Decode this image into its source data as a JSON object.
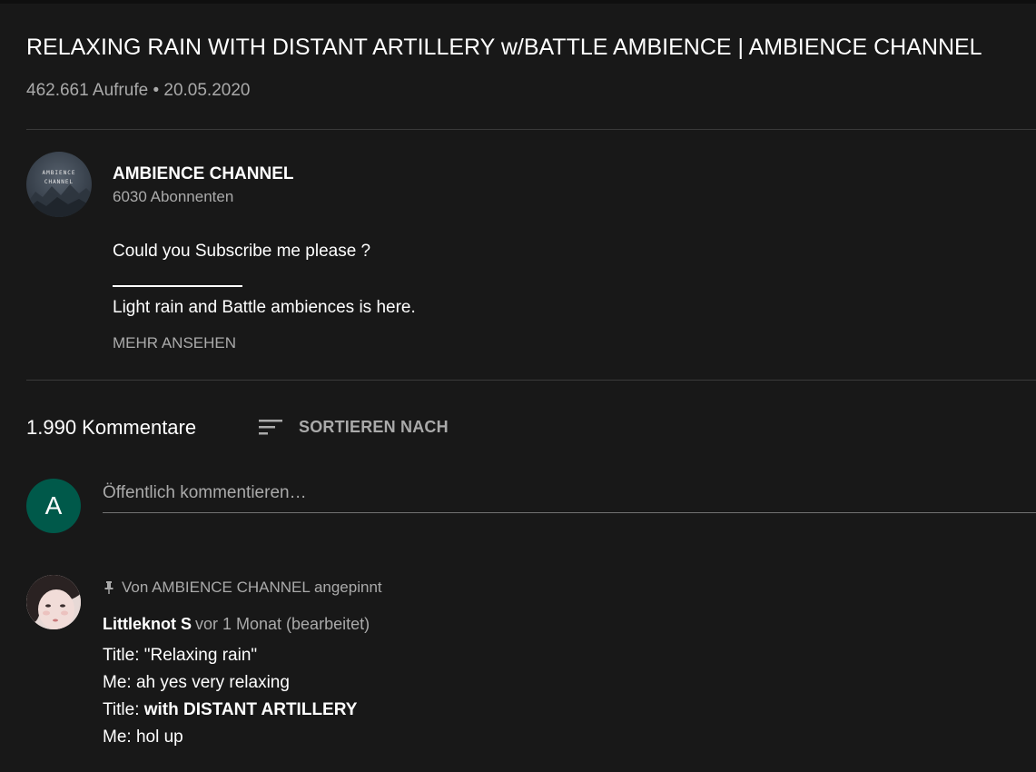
{
  "video": {
    "title": "RELAXING RAIN WITH DISTANT ARTILLERY w/BATTLE AMBIENCE | AMBIENCE CHANNEL",
    "meta": "462.661 Aufrufe • 20.05.2020"
  },
  "channel": {
    "avatar_text_line1": "AMBIENCE",
    "avatar_text_line2": "CHANNEL",
    "name": "AMBIENCE CHANNEL",
    "subscribers": "6030 Abonnenten"
  },
  "description": {
    "line1": "Could you Subscribe me please ?",
    "line2": "Light rain and Battle ambiences is here.",
    "show_more": "MEHR ANSEHEN"
  },
  "comments": {
    "count": "1.990 Kommentare",
    "sort_label": "SORTIEREN NACH",
    "user_initial": "A",
    "input_placeholder": "Öffentlich kommentieren…",
    "pinned_comment": {
      "pinned_label": "Von AMBIENCE CHANNEL angepinnt",
      "author": "Littleknot S",
      "time": "vor 1 Monat (bearbeitet)",
      "line1": "Title: \"Relaxing rain\"",
      "line2": "Me: ah yes very relaxing",
      "line3_prefix": "Title: ",
      "line3_bold": "with DISTANT ARTILLERY",
      "line4": "Me: hol up"
    }
  },
  "colors": {
    "background": "#181818",
    "secondary_text": "#aaaaaa",
    "user_avatar": "#00594a",
    "divider": "#3a3a3a"
  },
  "icons": {
    "sort": "sort-lines-icon",
    "pin": "pin-icon"
  }
}
